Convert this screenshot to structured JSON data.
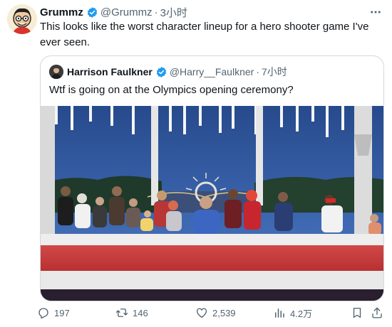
{
  "author": {
    "name": "Grummz",
    "handle": "@Grummz",
    "separator": "·",
    "time": "3小时"
  },
  "tweet_text": "This looks like the worst character lineup for a hero shooter game I've ever seen.",
  "quote": {
    "name": "Harrison Faulkner",
    "handle": "@Harry__Faulkner",
    "separator": "·",
    "time": "7小时",
    "text": "Wtf is going on at the Olympics opening ceremony?"
  },
  "actions": {
    "replies": "197",
    "reposts": "146",
    "likes": "2,539",
    "views": "4.2万"
  },
  "colors": {
    "verified": "#1d9bf0",
    "secondary_text": "#536471",
    "border": "#cfd9de",
    "table_red": "#c73a3a"
  },
  "icons": {
    "more": "more-icon",
    "reply": "reply-icon",
    "repost": "repost-icon",
    "like": "heart-icon",
    "views": "views-icon",
    "bookmark": "bookmark-icon",
    "share": "share-icon"
  }
}
